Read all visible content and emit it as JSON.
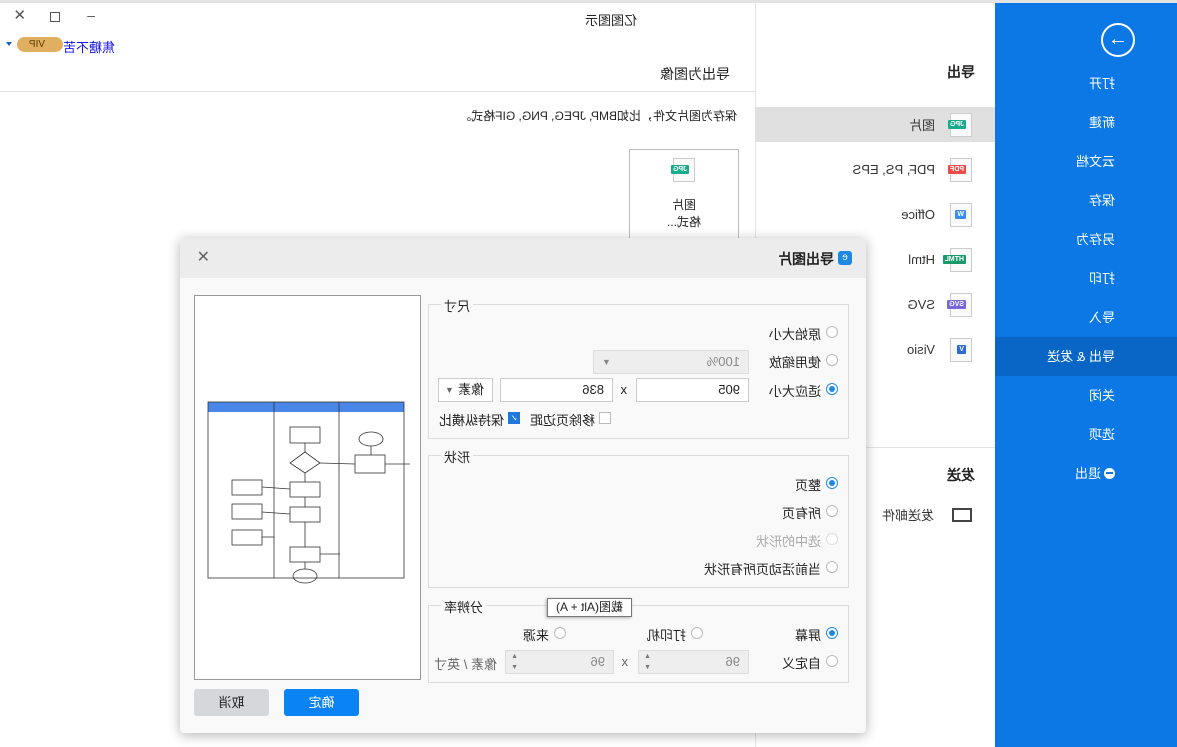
{
  "window": {
    "title": "亿图图示",
    "user": "焦糖不苦",
    "vip": "VIP"
  },
  "sidebar": {
    "items": [
      {
        "label": "打开"
      },
      {
        "label": "新建"
      },
      {
        "label": "云文档"
      },
      {
        "label": "保存"
      },
      {
        "label": "另存为"
      },
      {
        "label": "打印"
      },
      {
        "label": "导入"
      },
      {
        "label": "导出 & 发送",
        "active": true
      },
      {
        "label": "关闭"
      },
      {
        "label": "选项"
      },
      {
        "label": "退出"
      }
    ],
    "color": "#0b78e6"
  },
  "export": {
    "header": "导出",
    "items": [
      {
        "label": "图片",
        "badge": "JPG",
        "color": "#1aaa8c"
      },
      {
        "label": "PDF, PS, EPS",
        "badge": "PDF",
        "color": "#ef4b4b"
      },
      {
        "label": "Office",
        "badge": "W",
        "color": "#3b8ef0"
      },
      {
        "label": "Html",
        "badge": "HTML",
        "color": "#1a9a6a"
      },
      {
        "label": "SVG",
        "badge": "SVG",
        "color": "#7b68d8"
      },
      {
        "label": "Visio",
        "badge": "V",
        "color": "#2b6bd6"
      }
    ],
    "send_header": "发送",
    "send_items": [
      {
        "label": "发送邮件"
      }
    ]
  },
  "content": {
    "title": "导出为图像",
    "description": "保存为图片文件，比如BMP, JPEG, PNG, GIF格式。",
    "card_title": "图片",
    "card_sub": "格式...",
    "card_badge": "JPG"
  },
  "dialog": {
    "title": "导出图片",
    "size": {
      "label": "尺寸",
      "original": "原始大小",
      "zoom": "使用缩放",
      "zoom_value": "100%",
      "fit": "适应大小",
      "width": "905",
      "height": "836",
      "unit": "像素",
      "x": "x",
      "remove_margin": "移除页边距",
      "keep_ratio": "保持纵横比",
      "keep_ratio_checked": true,
      "selected": "适应大小"
    },
    "shape": {
      "label": "形状",
      "options": [
        "整页",
        "所有页",
        "选中的形状",
        "当前活动页所有形状"
      ],
      "selected": "整页"
    },
    "resolution": {
      "label": "分辨率",
      "screen": "屏幕",
      "printer": "打印机",
      "source": "来源",
      "custom": "自定义",
      "dpi_x": "96",
      "dpi_y": "96",
      "x": "x",
      "unit": "像素 / 英寸",
      "selected": "屏幕"
    },
    "tooltip": "截图(Alt + A)",
    "ok": "确定",
    "cancel": "取消"
  }
}
